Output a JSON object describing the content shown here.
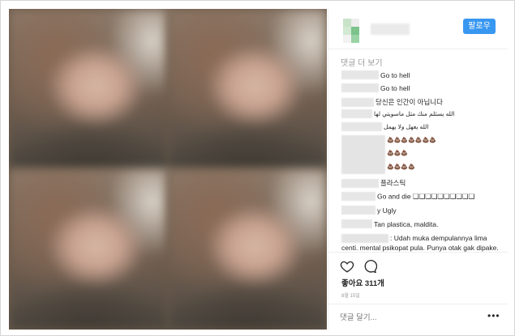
{
  "post": {
    "follow_label": "팔로우",
    "load_more_label": "댓글 더 보기",
    "comments": [
      {
        "text": "Go to hell"
      },
      {
        "text": "Go to hell"
      },
      {
        "text": "당신은 인간이 아닙니다"
      },
      {
        "text": "الله يسئلم منك مثل ماسويتي لها"
      },
      {
        "text": "الله يعهل ولا يهمل"
      },
      {
        "text": "💩💩💩💩💩💩💩"
      },
      {
        "text": "💩💩💩"
      },
      {
        "text": "💩💩💩💩"
      },
      {
        "text": "플라스틱"
      },
      {
        "text": "Go and die ❏❏❏❏❏❏❏❏❏❏"
      },
      {
        "text": "y Ugly"
      },
      {
        "text": "Tan plastica, maldita."
      },
      {
        "text": ": Udah muka dempulannya lima centi. mental psikopat pula. Punya otak gak dipake."
      }
    ],
    "likes_label": "좋아요 311개",
    "date_label": "8월 15일",
    "comment_placeholder": "댓글 달기...",
    "more_options": "•••",
    "accent_color": "#3897f0"
  }
}
